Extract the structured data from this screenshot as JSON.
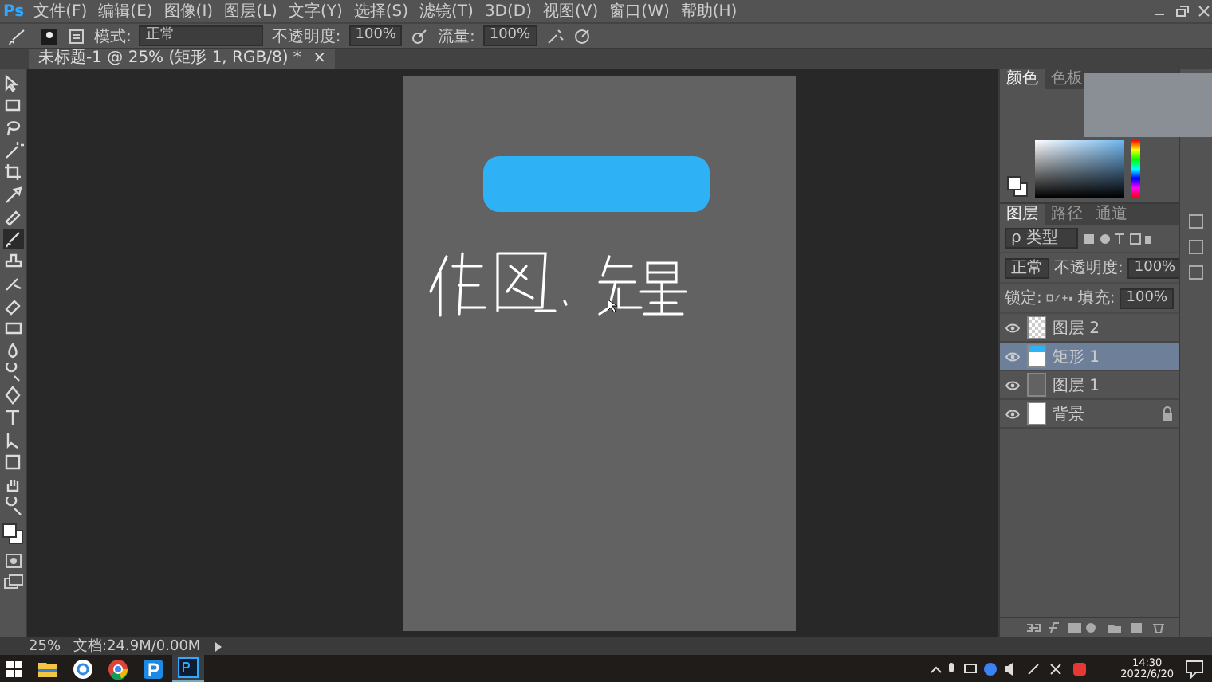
{
  "app": {
    "logo": "Ps",
    "menu": [
      "文件(F)",
      "编辑(E)",
      "图像(I)",
      "图层(L)",
      "文字(Y)",
      "选择(S)",
      "滤镜(T)",
      "3D(D)",
      "视图(V)",
      "窗口(W)",
      "帮助(H)"
    ]
  },
  "options": {
    "mode_label": "模式:",
    "mode": "正常",
    "opacity_label": "不透明度:",
    "opacity": "100%",
    "flow_label": "流量:",
    "flow": "100%"
  },
  "document_tab": {
    "title": "未标题-1 @ 25% (矩形 1, RGB/8) *",
    "close": "×"
  },
  "toolbar": {
    "tools": [
      {
        "kind": "move",
        "selected": false
      },
      {
        "kind": "marquee",
        "selected": false
      },
      {
        "kind": "lasso",
        "selected": false
      },
      {
        "kind": "wand",
        "selected": false
      },
      {
        "kind": "crop",
        "selected": false
      },
      {
        "kind": "eyedropper",
        "selected": false
      },
      {
        "kind": "heal",
        "selected": false
      },
      {
        "kind": "brush",
        "selected": true
      },
      {
        "kind": "stamp",
        "selected": false
      },
      {
        "kind": "history",
        "selected": false
      },
      {
        "kind": "eraser",
        "selected": false
      },
      {
        "kind": "gradient",
        "selected": false
      },
      {
        "kind": "blur",
        "selected": false
      },
      {
        "kind": "dodge",
        "selected": false
      },
      {
        "kind": "pen",
        "selected": false
      },
      {
        "kind": "type",
        "selected": false
      },
      {
        "kind": "path",
        "selected": false
      },
      {
        "kind": "shape",
        "selected": false
      },
      {
        "kind": "hand",
        "selected": false
      },
      {
        "kind": "zoom",
        "selected": false
      }
    ]
  },
  "color_panel": {
    "tabs": [
      {
        "label": "颜色",
        "selected": true
      },
      {
        "label": "色板",
        "selected": false
      }
    ]
  },
  "layers_panel": {
    "tabs": [
      {
        "label": "图层",
        "selected": true
      },
      {
        "label": "路径",
        "selected": false
      },
      {
        "label": "通道",
        "selected": false
      }
    ],
    "filter": "ρ 类型",
    "blend": "正常",
    "opacity_label": "不透明度:",
    "opacity": "100%",
    "lock_label": "锁定:",
    "fill_label": "填充:",
    "fill": "100%",
    "layers": [
      {
        "name": "图层 2",
        "kind": "transparent",
        "selected": false,
        "visible": true,
        "locked": false
      },
      {
        "name": "矩形 1",
        "kind": "shape",
        "selected": true,
        "visible": true,
        "locked": false
      },
      {
        "name": "图层 1",
        "kind": "gray",
        "selected": false,
        "visible": true,
        "locked": false
      },
      {
        "name": "背景",
        "kind": "white",
        "selected": false,
        "visible": true,
        "locked": true
      }
    ]
  },
  "status_bar": {
    "zoom": "25%",
    "doc": "文档:24.9M/0.00M"
  },
  "taskbar": {
    "time": "14:30",
    "date": "2022/6/20"
  }
}
